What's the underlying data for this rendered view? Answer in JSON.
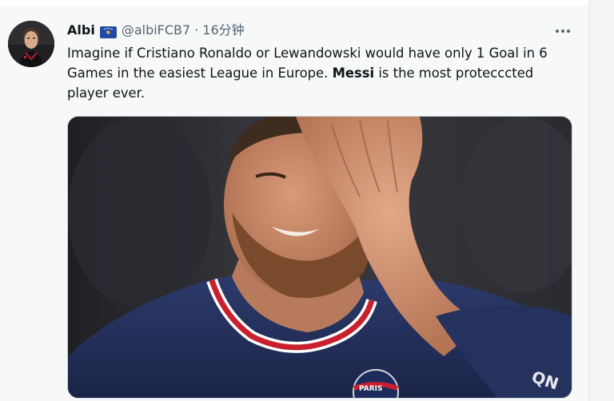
{
  "tweet": {
    "display_name": "Albi",
    "flag": "kosovo-flag",
    "handle": "@albiFCB7",
    "separator": "·",
    "time": "16分钟",
    "text_before": "Imagine if Cristiano Ronaldo or Lewandowski would have only 1 Goal in 6 Games in the easiest League in Europe. ",
    "text_bold": "Messi",
    "text_after": " is the most protecccted player ever.",
    "more_icon": "more-horizontal-icon",
    "media": {
      "kind": "photo",
      "shirt_crest_text": "PARIS",
      "sponsor_text": "QN"
    }
  },
  "colors": {
    "primary_text": "#0f1419",
    "secondary_text": "#536471",
    "background": "#f7f9f9",
    "border": "#cfd9de"
  }
}
